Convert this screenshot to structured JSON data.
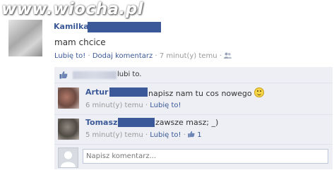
{
  "watermark": "www.wiocha.pl",
  "post": {
    "author": "Kamilka",
    "text": "mam chcice",
    "like_link": "Lubię to!",
    "separator": "·",
    "comment_link": "Dodaj komentarz",
    "time": "7 minut(y) temu"
  },
  "likes": {
    "text": "lubi to."
  },
  "comments": [
    {
      "author": "Artur",
      "text": "napisz nam tu cos nowego",
      "time": "6 minut(y) temu",
      "separator": "·",
      "like_link": "Lubię to!",
      "emoticon": "smile-icon"
    },
    {
      "author": "Tomasz",
      "text": "zawsze masz; _)",
      "time": "5 minut(y) temu",
      "separator": "·",
      "like_link": "Lubię to!",
      "like_count": "1"
    }
  ],
  "composer": {
    "placeholder": "Napisz komentarz..."
  },
  "colors": {
    "link": "#3b5998",
    "redaction": "#3b5998",
    "comment_bg": "#edeff4",
    "meta_text": "#999999"
  }
}
